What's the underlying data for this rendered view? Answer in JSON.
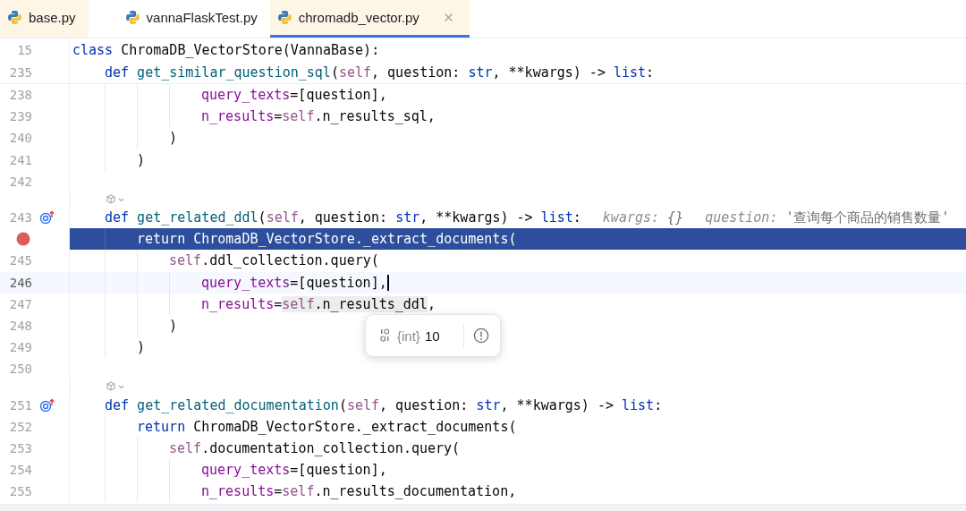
{
  "tabs": [
    {
      "label": "base.py",
      "selected": false,
      "tinted": true,
      "closable": false
    },
    {
      "label": "vannaFlaskTest.py",
      "selected": false,
      "tinted": false,
      "closable": false
    },
    {
      "label": "chromadb_vector.py",
      "selected": true,
      "tinted": true,
      "closable": true
    }
  ],
  "sticky_lines": [
    {
      "kind": "code",
      "number": "15",
      "tokens": [
        {
          "t": "class",
          "kind": "kw"
        },
        {
          "t": " ChromaDB_VectorStore(VannaBase):",
          "kind": "plain"
        }
      ],
      "children": [
        {
          "kind": "code",
          "number": "235",
          "tokens": [
            {
              "t": "def",
              "kind": "kw"
            },
            {
              "t": " get_similar_question_sql",
              "kind": "fn"
            },
            {
              "t": "(",
              "kind": "plain"
            },
            {
              "t": "self",
              "kind": "self"
            },
            {
              "t": ", question: ",
              "kind": "plain"
            },
            {
              "t": "str",
              "kind": "kw"
            },
            {
              "t": ", **kwargs) -> ",
              "kind": "plain"
            },
            {
              "t": "list",
              "kind": "kw"
            },
            {
              "t": ":",
              "kind": "plain"
            }
          ]
        }
      ]
    }
  ],
  "lines": [
    {
      "kind": "continuation",
      "children": [
        {
          "kind": "continuation",
          "children": [
            {
              "kind": "continuation",
              "children": [
                {
                  "kind": "code",
                  "number": "238",
                  "tokens": [
                    {
                      "t": "query_texts",
                      "kind": "param"
                    },
                    {
                      "t": "=[question],",
                      "kind": "plain"
                    }
                  ]
                },
                {
                  "kind": "code",
                  "number": "239",
                  "tokens": [
                    {
                      "t": "n_results",
                      "kind": "param"
                    },
                    {
                      "t": "=",
                      "kind": "plain"
                    },
                    {
                      "t": "self",
                      "kind": "self"
                    },
                    {
                      "t": ".n_results_sql,",
                      "kind": "plain"
                    }
                  ]
                }
              ]
            },
            {
              "kind": "code",
              "number": "240",
              "tokens": [
                {
                  "t": ")",
                  "kind": "plain"
                }
              ]
            }
          ]
        },
        {
          "kind": "code",
          "number": "241",
          "tokens": [
            {
              "t": ")",
              "kind": "plain"
            }
          ]
        }
      ]
    },
    {
      "kind": "code",
      "number": "242"
    },
    {
      "kind": "hint_row"
    },
    {
      "kind": "code",
      "number": "243",
      "overrides": true,
      "tokens": [
        {
          "t": "def",
          "kind": "kw"
        },
        {
          "t": " get_related_ddl",
          "kind": "fn"
        },
        {
          "t": "(",
          "kind": "plain"
        },
        {
          "t": "self",
          "kind": "self"
        },
        {
          "t": ", question: ",
          "kind": "plain"
        },
        {
          "t": "str",
          "kind": "kw"
        },
        {
          "t": ", **kwargs) -> ",
          "kind": "plain"
        },
        {
          "t": "list",
          "kind": "kw"
        },
        {
          "t": ":",
          "kind": "plain"
        }
      ],
      "hints": [
        {
          "name": "kwargs:",
          "value": "{}"
        },
        {
          "name": "question:",
          "value": "'查询每个商品的销售数量'"
        }
      ],
      "children": [
        {
          "kind": "code",
          "breakpoint": true,
          "execution": true,
          "tokens": [
            {
              "t": "return",
              "kind": "kw"
            },
            {
              "t": " ChromaDB_VectorStore._extract_documents(",
              "kind": "plain"
            }
          ],
          "children": [
            {
              "kind": "code",
              "number": "245",
              "tokens": [
                {
                  "t": "self",
                  "kind": "self"
                },
                {
                  "t": ".ddl_collection.query(",
                  "kind": "plain"
                }
              ],
              "children": [
                {
                  "kind": "code",
                  "number": "246",
                  "current": true,
                  "caret": true,
                  "tokens": [
                    {
                      "t": "query_texts",
                      "kind": "param"
                    },
                    {
                      "t": "=[question],",
                      "kind": "plain"
                    }
                  ]
                },
                {
                  "kind": "code",
                  "number": "247",
                  "tokens": [
                    {
                      "t": "n_results",
                      "kind": "param"
                    },
                    {
                      "t": "=",
                      "kind": "plain"
                    },
                    {
                      "t": "self",
                      "kind": "self",
                      "highlighted": true
                    },
                    {
                      "t": ".n_results_ddl",
                      "kind": "plain",
                      "highlighted": true
                    },
                    {
                      "t": ",",
                      "kind": "plain"
                    }
                  ]
                }
              ]
            },
            {
              "kind": "code",
              "number": "248",
              "tokens": [
                {
                  "t": ")",
                  "kind": "plain"
                }
              ]
            }
          ]
        },
        {
          "kind": "code",
          "number": "249",
          "tokens": [
            {
              "t": ")",
              "kind": "plain"
            }
          ]
        }
      ]
    },
    {
      "kind": "code",
      "number": "250"
    },
    {
      "kind": "hint_row"
    },
    {
      "kind": "code",
      "number": "251",
      "overrides": true,
      "tokens": [
        {
          "t": "def",
          "kind": "kw"
        },
        {
          "t": " get_related_documentation",
          "kind": "fn"
        },
        {
          "t": "(",
          "kind": "plain"
        },
        {
          "t": "self",
          "kind": "self"
        },
        {
          "t": ", question: ",
          "kind": "plain"
        },
        {
          "t": "str",
          "kind": "kw"
        },
        {
          "t": ", **kwargs) -> ",
          "kind": "plain"
        },
        {
          "t": "list",
          "kind": "kw"
        },
        {
          "t": ":",
          "kind": "plain"
        }
      ],
      "children": [
        {
          "kind": "code",
          "number": "252",
          "tokens": [
            {
              "t": "return",
              "kind": "kw"
            },
            {
              "t": " ChromaDB_VectorStore._extract_documents(",
              "kind": "plain"
            }
          ],
          "children": [
            {
              "kind": "code",
              "number": "253",
              "tokens": [
                {
                  "t": "self",
                  "kind": "self"
                },
                {
                  "t": ".documentation_collection.query(",
                  "kind": "plain"
                }
              ],
              "children": [
                {
                  "kind": "code",
                  "number": "254",
                  "tokens": [
                    {
                      "t": "query_texts",
                      "kind": "param"
                    },
                    {
                      "t": "=[question],",
                      "kind": "plain"
                    }
                  ]
                },
                {
                  "kind": "code",
                  "number": "255",
                  "tokens": [
                    {
                      "t": "n_results",
                      "kind": "param"
                    },
                    {
                      "t": "=",
                      "kind": "plain"
                    },
                    {
                      "t": "self",
                      "kind": "self"
                    },
                    {
                      "t": ".n_results_documentation,",
                      "kind": "plain"
                    }
                  ]
                }
              ]
            }
          ]
        }
      ]
    }
  ],
  "popup": {
    "type": "{int}",
    "value": "10"
  }
}
